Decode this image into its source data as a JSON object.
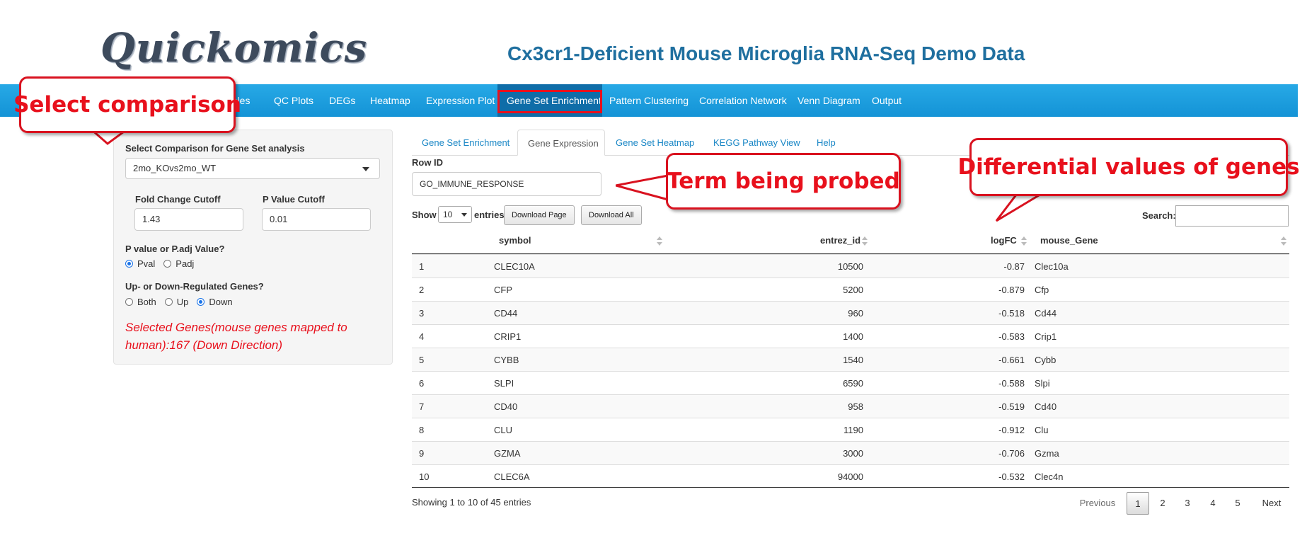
{
  "app": {
    "logo": "Quickomics",
    "title": "Cx3cr1-Deficient Mouse Microglia RNA-Seq Demo Data"
  },
  "nav": {
    "items": [
      {
        "label": "Samples",
        "visible": "nples"
      },
      {
        "label": "QC Plots"
      },
      {
        "label": "DEGs"
      },
      {
        "label": "Heatmap"
      },
      {
        "label": "Expression Plot"
      },
      {
        "label": "Gene Set Enrichment"
      },
      {
        "label": "Pattern Clustering"
      },
      {
        "label": "Correlation Network"
      },
      {
        "label": "Venn Diagram"
      },
      {
        "label": "Output"
      }
    ],
    "active": "Gene Set Enrichment",
    "active_color": "#0f6da8",
    "bar_color": "#1493d6"
  },
  "sidebar": {
    "comparison_label": "Select Comparison for Gene Set analysis",
    "comparison_value": "2mo_KOvs2mo_WT",
    "fc_label": "Fold Change Cutoff",
    "fc_value": "1.43",
    "p_label": "P Value Cutoff",
    "p_value": "0.01",
    "pval_type_label": "P value or P.adj Value?",
    "pval_options": [
      "Pval",
      "Padj"
    ],
    "pval_selected": "Pval",
    "direction_label": "Up- or Down-Regulated Genes?",
    "direction_options": [
      "Both",
      "Up",
      "Down"
    ],
    "direction_selected": "Down",
    "selected_genes_text": "Selected Genes(mouse genes mapped to human):167 (Down Direction)"
  },
  "tabs": {
    "items": [
      "Gene Set Enrichment",
      "Gene Expression",
      "Gene Set Heatmap",
      "KEGG Pathway View",
      "Help"
    ],
    "active": "Gene Expression"
  },
  "panel": {
    "row_id_label": "Row ID",
    "row_id_value": "GO_IMMUNE_RESPONSE",
    "show_label": "Show",
    "entries_value": "10",
    "entries_label": "entries",
    "download_page": "Download Page",
    "download_all": "Download All",
    "search_label": "Search:"
  },
  "table": {
    "columns": [
      "symbol",
      "entrez_id",
      "logFC",
      "mouse_Gene"
    ],
    "rows": [
      {
        "idx": "1",
        "symbol": "CLEC10A",
        "entrez_id": "10500",
        "logFC": "-0.87",
        "mouse_Gene": "Clec10a"
      },
      {
        "idx": "2",
        "symbol": "CFP",
        "entrez_id": "5200",
        "logFC": "-0.879",
        "mouse_Gene": "Cfp"
      },
      {
        "idx": "3",
        "symbol": "CD44",
        "entrez_id": "960",
        "logFC": "-0.518",
        "mouse_Gene": "Cd44"
      },
      {
        "idx": "4",
        "symbol": "CRIP1",
        "entrez_id": "1400",
        "logFC": "-0.583",
        "mouse_Gene": "Crip1"
      },
      {
        "idx": "5",
        "symbol": "CYBB",
        "entrez_id": "1540",
        "logFC": "-0.661",
        "mouse_Gene": "Cybb"
      },
      {
        "idx": "6",
        "symbol": "SLPI",
        "entrez_id": "6590",
        "logFC": "-0.588",
        "mouse_Gene": "Slpi"
      },
      {
        "idx": "7",
        "symbol": "CD40",
        "entrez_id": "958",
        "logFC": "-0.519",
        "mouse_Gene": "Cd40"
      },
      {
        "idx": "8",
        "symbol": "CLU",
        "entrez_id": "1190",
        "logFC": "-0.912",
        "mouse_Gene": "Clu"
      },
      {
        "idx": "9",
        "symbol": "GZMA",
        "entrez_id": "3000",
        "logFC": "-0.706",
        "mouse_Gene": "Gzma"
      },
      {
        "idx": "10",
        "symbol": "CLEC6A",
        "entrez_id": "94000",
        "logFC": "-0.532",
        "mouse_Gene": "Clec4n"
      }
    ],
    "info": "Showing 1 to 10 of 45 entries"
  },
  "pagination": {
    "previous": "Previous",
    "pages": [
      "1",
      "2",
      "3",
      "4",
      "5"
    ],
    "current": "1",
    "next": "Next"
  },
  "callouts": {
    "select_comparison": "Select comparison",
    "term_probed": "Term being probed",
    "differential": "Differential values of genes",
    "color": "#e8101c"
  }
}
